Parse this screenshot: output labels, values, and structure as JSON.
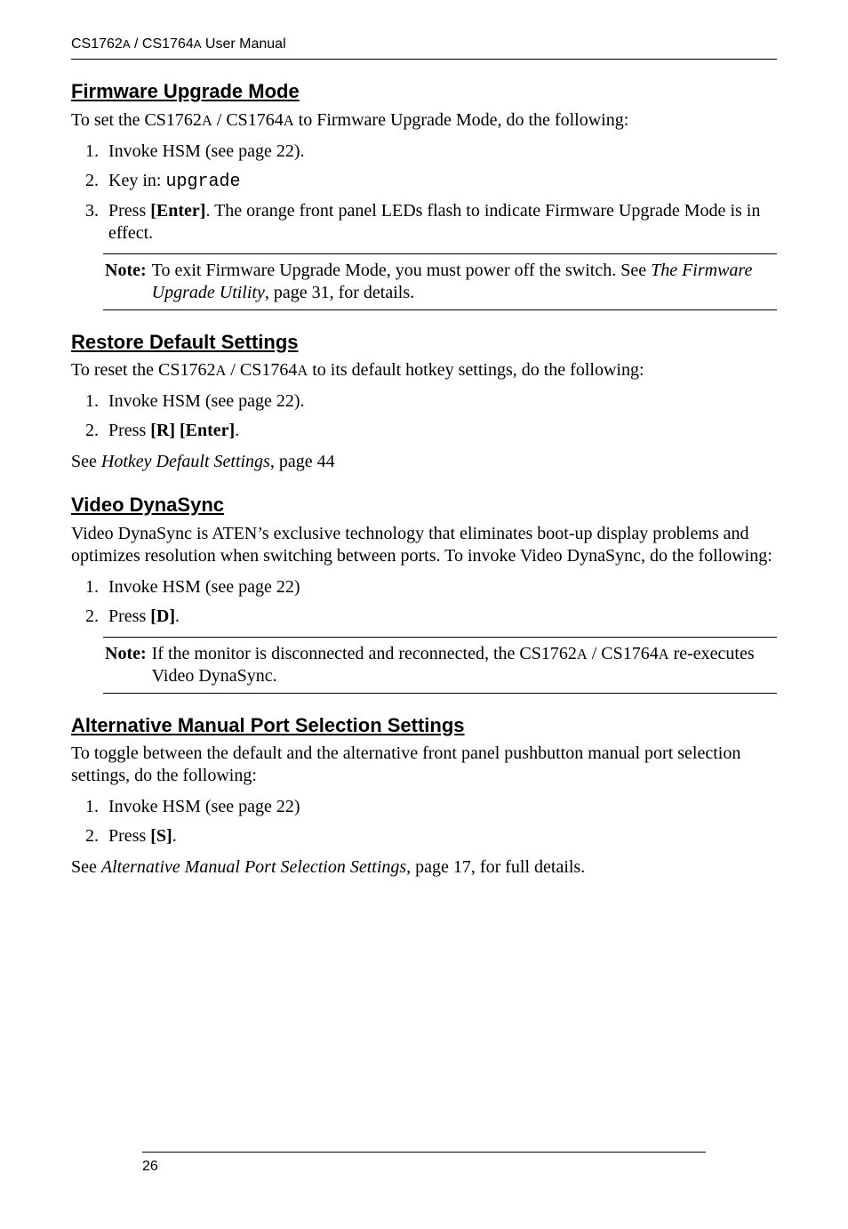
{
  "header": "CS1762A / CS1764A User Manual",
  "sections": [
    {
      "heading": "Firmware Upgrade Mode",
      "intro": "To set the CS1762A / CS1764A to Firmware Upgrade Mode, do the following:",
      "steps": [
        "Invoke HSM (see page 22).",
        "Key in: upgrade",
        "Press [Enter]. The orange front panel LEDs flash to indicate Firmware Upgrade Mode is in effect."
      ],
      "note_label": "Note:",
      "note": "To exit Firmware Upgrade Mode, you must power off the switch. See The Firmware Upgrade Utility, page 31, for details.",
      "after": ""
    },
    {
      "heading": "Restore Default Settings",
      "intro": "To reset the CS1762A / CS1764A to its default hotkey settings, do the following:",
      "steps": [
        "Invoke HSM (see page 22).",
        "Press [R] [Enter]."
      ],
      "after": "See Hotkey Default Settings, page 44"
    },
    {
      "heading": "Video DynaSync",
      "intro": "Video DynaSync is ATEN’s exclusive technology that eliminates boot-up display problems and optimizes resolution when switching between ports. To invoke Video DynaSync, do the following:",
      "steps": [
        "Invoke HSM (see page 22)",
        "Press [D]."
      ],
      "note_label": "Note:",
      "note": "If the monitor is disconnected and reconnected, the CS1762A / CS1764A re-executes Video DynaSync.",
      "after": ""
    },
    {
      "heading": "Alternative Manual Port Selection Settings",
      "intro": "To toggle between the default and the alternative front panel pushbutton manual port selection settings, do the following:",
      "steps": [
        "Invoke HSM (see page 22)",
        "Press [S]."
      ],
      "after": "See Alternative Manual Port Selection Settings, page 17, for full details."
    }
  ],
  "page_number": "26"
}
